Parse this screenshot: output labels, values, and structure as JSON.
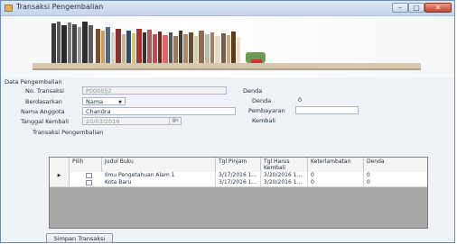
{
  "window": {
    "title": "Transaksi Pengembalian",
    "min_label": "–",
    "max_label": "□",
    "close_label": "✕"
  },
  "section_title": "Data Pengembalian",
  "form": {
    "no_transaksi_label": "No. Transaksi",
    "no_transaksi_value": "P000052",
    "berdasarkan_label": "Berdasarkan",
    "berdasarkan_value": "Nama",
    "nama_anggota_label": "Nama Anggota",
    "nama_anggota_value": "Chandra",
    "tanggal_kembali_label": "Tanggal Kembali",
    "tanggal_kembali_value": "20/03/2016"
  },
  "denda": {
    "group_title": "Denda",
    "denda_label": "Denda",
    "denda_value": "0",
    "pembayaran_label": "Pembayaran",
    "pembayaran_value": "",
    "kembali_label": "Kembali"
  },
  "table": {
    "group_title": "Transaksi Pengembalian",
    "columns": [
      "Pilih",
      "Judul Buku",
      "Tgl Pinjam",
      "Tgl Harus Kembali",
      "Keterlambatan",
      "Denda"
    ],
    "rows": [
      {
        "marker": "▶",
        "judul": "Ilmu Pengetahuan Alam 1",
        "tgl_pinjam": "3/17/2016 1...",
        "tgl_kembali": "3/20/2016 1...",
        "keterlambatan": "0",
        "denda": "0"
      },
      {
        "marker": "",
        "judul": "Kota Baru",
        "tgl_pinjam": "3/17/2016 1...",
        "tgl_kembali": "3/20/2016 1...",
        "keterlambatan": "0",
        "denda": "0"
      }
    ]
  },
  "save_button_label": "Simpan Transaksi",
  "colors": {
    "titlebar": "#c3d5ec",
    "grid_background": "#a6a6a6",
    "close_button": "#c4452f"
  }
}
